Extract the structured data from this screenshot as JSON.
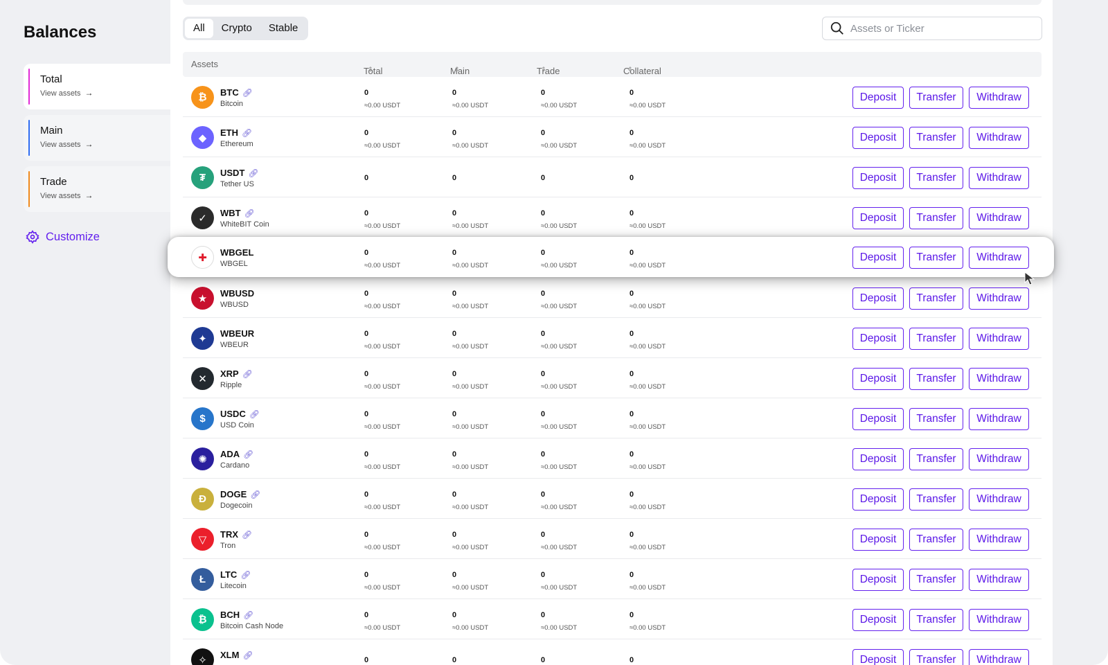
{
  "sidebar": {
    "title": "Balances",
    "cards": [
      {
        "name": "Total",
        "sub": "View assets",
        "color": "#e22bd6",
        "active": true
      },
      {
        "name": "Main",
        "sub": "View assets",
        "color": "#2f6df2",
        "active": false
      },
      {
        "name": "Trade",
        "sub": "View assets",
        "color": "#f08a1c",
        "active": false
      }
    ],
    "customize_label": "Customize"
  },
  "filters": {
    "tabs": [
      "All",
      "Crypto",
      "Stable"
    ],
    "active": "All"
  },
  "search": {
    "placeholder": "Assets or Ticker"
  },
  "table": {
    "headers": [
      "Assets",
      "Total",
      "Main",
      "Trade",
      "Collateral"
    ],
    "actions": {
      "deposit": "Deposit",
      "transfer": "Transfer",
      "withdraw": "Withdraw"
    },
    "rows": [
      {
        "sym": "BTC",
        "name": "Bitcoin",
        "icon": "bitcoin-icon",
        "color": "#f7931a",
        "glyph": "₿",
        "total": "0",
        "main": "0",
        "trade": "0",
        "collateral": "0",
        "usd": "≈0.00 USDT"
      },
      {
        "sym": "ETH",
        "name": "Ethereum",
        "icon": "ethereum-icon",
        "color": "#6c63ff",
        "glyph": "◆",
        "total": "0",
        "main": "0",
        "trade": "0",
        "collateral": "0",
        "usd": "≈0.00 USDT"
      },
      {
        "sym": "USDT",
        "name": "Tether US",
        "icon": "tether-icon",
        "color": "#26a17b",
        "glyph": "₮",
        "total": "0",
        "main": "0",
        "trade": "0",
        "collateral": "0",
        "usd": ""
      },
      {
        "sym": "WBT",
        "name": "WhiteBIT Coin",
        "icon": "whitebit-icon",
        "color": "#2b2b2b",
        "glyph": "✓",
        "total": "0",
        "main": "0",
        "trade": "0",
        "collateral": "0",
        "usd": "≈0.00 USDT"
      },
      {
        "sym": "WBGEL",
        "name": "WBGEL",
        "icon": "georgia-flag-icon",
        "color": "#ffffff",
        "glyph": "✚",
        "total": "0",
        "main": "0",
        "trade": "0",
        "collateral": "0",
        "usd": "≈0.00 USDT"
      },
      {
        "sym": "WBUSD",
        "name": "WBUSD",
        "icon": "us-flag-icon",
        "color": "#c8102e",
        "glyph": "★",
        "total": "0",
        "main": "0",
        "trade": "0",
        "collateral": "0",
        "usd": "≈0.00 USDT"
      },
      {
        "sym": "WBEUR",
        "name": "WBEUR",
        "icon": "eu-flag-icon",
        "color": "#1f3a93",
        "glyph": "✦",
        "total": "0",
        "main": "0",
        "trade": "0",
        "collateral": "0",
        "usd": "≈0.00 USDT"
      },
      {
        "sym": "XRP",
        "name": "Ripple",
        "icon": "xrp-icon",
        "color": "#23292f",
        "glyph": "✕",
        "total": "0",
        "main": "0",
        "trade": "0",
        "collateral": "0",
        "usd": "≈0.00 USDT"
      },
      {
        "sym": "USDC",
        "name": "USD Coin",
        "icon": "usdc-icon",
        "color": "#2775ca",
        "glyph": "$",
        "total": "0",
        "main": "0",
        "trade": "0",
        "collateral": "0",
        "usd": "≈0.00 USDT"
      },
      {
        "sym": "ADA",
        "name": "Cardano",
        "icon": "cardano-icon",
        "color": "#2a1f9e",
        "glyph": "✺",
        "total": "0",
        "main": "0",
        "trade": "0",
        "collateral": "0",
        "usd": "≈0.00 USDT"
      },
      {
        "sym": "DOGE",
        "name": "Dogecoin",
        "icon": "dogecoin-icon",
        "color": "#c9b03c",
        "glyph": "Ð",
        "total": "0",
        "main": "0",
        "trade": "0",
        "collateral": "0",
        "usd": "≈0.00 USDT"
      },
      {
        "sym": "TRX",
        "name": "Tron",
        "icon": "tron-icon",
        "color": "#eb1f2b",
        "glyph": "▽",
        "total": "0",
        "main": "0",
        "trade": "0",
        "collateral": "0",
        "usd": "≈0.00 USDT"
      },
      {
        "sym": "LTC",
        "name": "Litecoin",
        "icon": "litecoin-icon",
        "color": "#345d9d",
        "glyph": "Ł",
        "total": "0",
        "main": "0",
        "trade": "0",
        "collateral": "0",
        "usd": "≈0.00 USDT"
      },
      {
        "sym": "BCH",
        "name": "Bitcoin Cash Node",
        "icon": "bitcoin-cash-icon",
        "color": "#0ac18e",
        "glyph": "₿",
        "total": "0",
        "main": "0",
        "trade": "0",
        "collateral": "0",
        "usd": "≈0.00 USDT"
      },
      {
        "sym": "XLM",
        "name": "",
        "icon": "stellar-icon",
        "color": "#111111",
        "glyph": "✧",
        "total": "0",
        "main": "0",
        "trade": "0",
        "collateral": "0",
        "usd": ""
      }
    ],
    "highlighted_row": 4
  }
}
